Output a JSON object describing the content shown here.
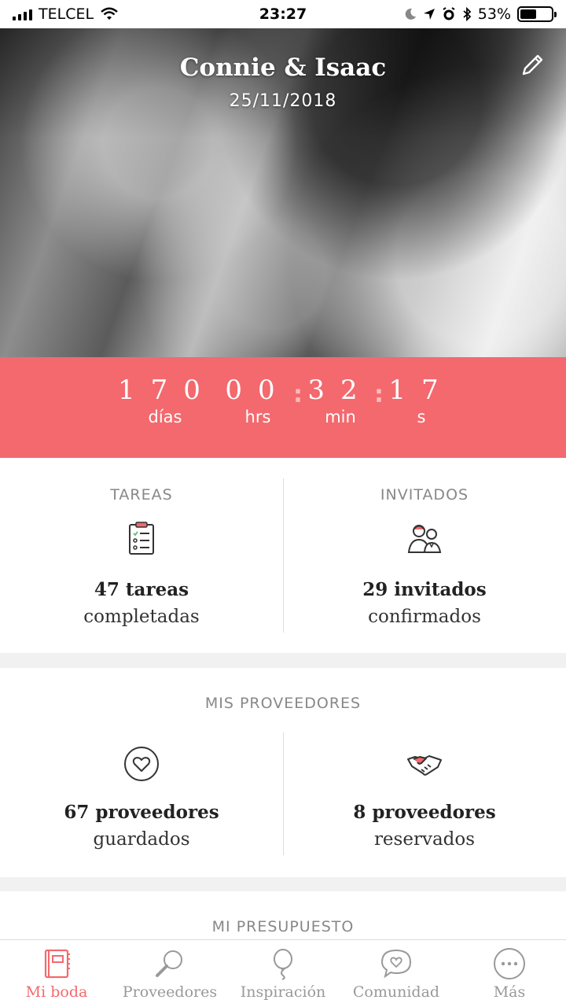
{
  "status_bar": {
    "carrier": "TELCEL",
    "time": "23:27",
    "battery": "53%"
  },
  "hero": {
    "title": "Connie & Isaac",
    "date": "25/11/2018"
  },
  "countdown": {
    "days": "170",
    "hours": "00",
    "minutes": "32",
    "seconds": "17",
    "days_label": "días",
    "hours_label": "hrs",
    "minutes_label": "min",
    "seconds_label": "s",
    "color": "#f3696e"
  },
  "tasks": {
    "title": "TAREAS",
    "count": "47 tareas",
    "status": "completadas"
  },
  "guests": {
    "title": "INVITADOS",
    "count": "29 invitados",
    "status": "confirmados"
  },
  "providers": {
    "title": "MIS PROVEEDORES",
    "saved_count": "67 proveedores",
    "saved_label": "guardados",
    "booked_count": "8 proveedores",
    "booked_label": "reservados"
  },
  "budget": {
    "title": "MI PRESUPUESTO"
  },
  "tabbar": [
    {
      "label": "Mi boda",
      "icon": "notebook-icon"
    },
    {
      "label": "Proveedores",
      "icon": "search-icon"
    },
    {
      "label": "Inspiración",
      "icon": "balloon-icon"
    },
    {
      "label": "Comunidad",
      "icon": "chat-heart-icon"
    },
    {
      "label": "Más",
      "icon": "more-icon"
    }
  ]
}
